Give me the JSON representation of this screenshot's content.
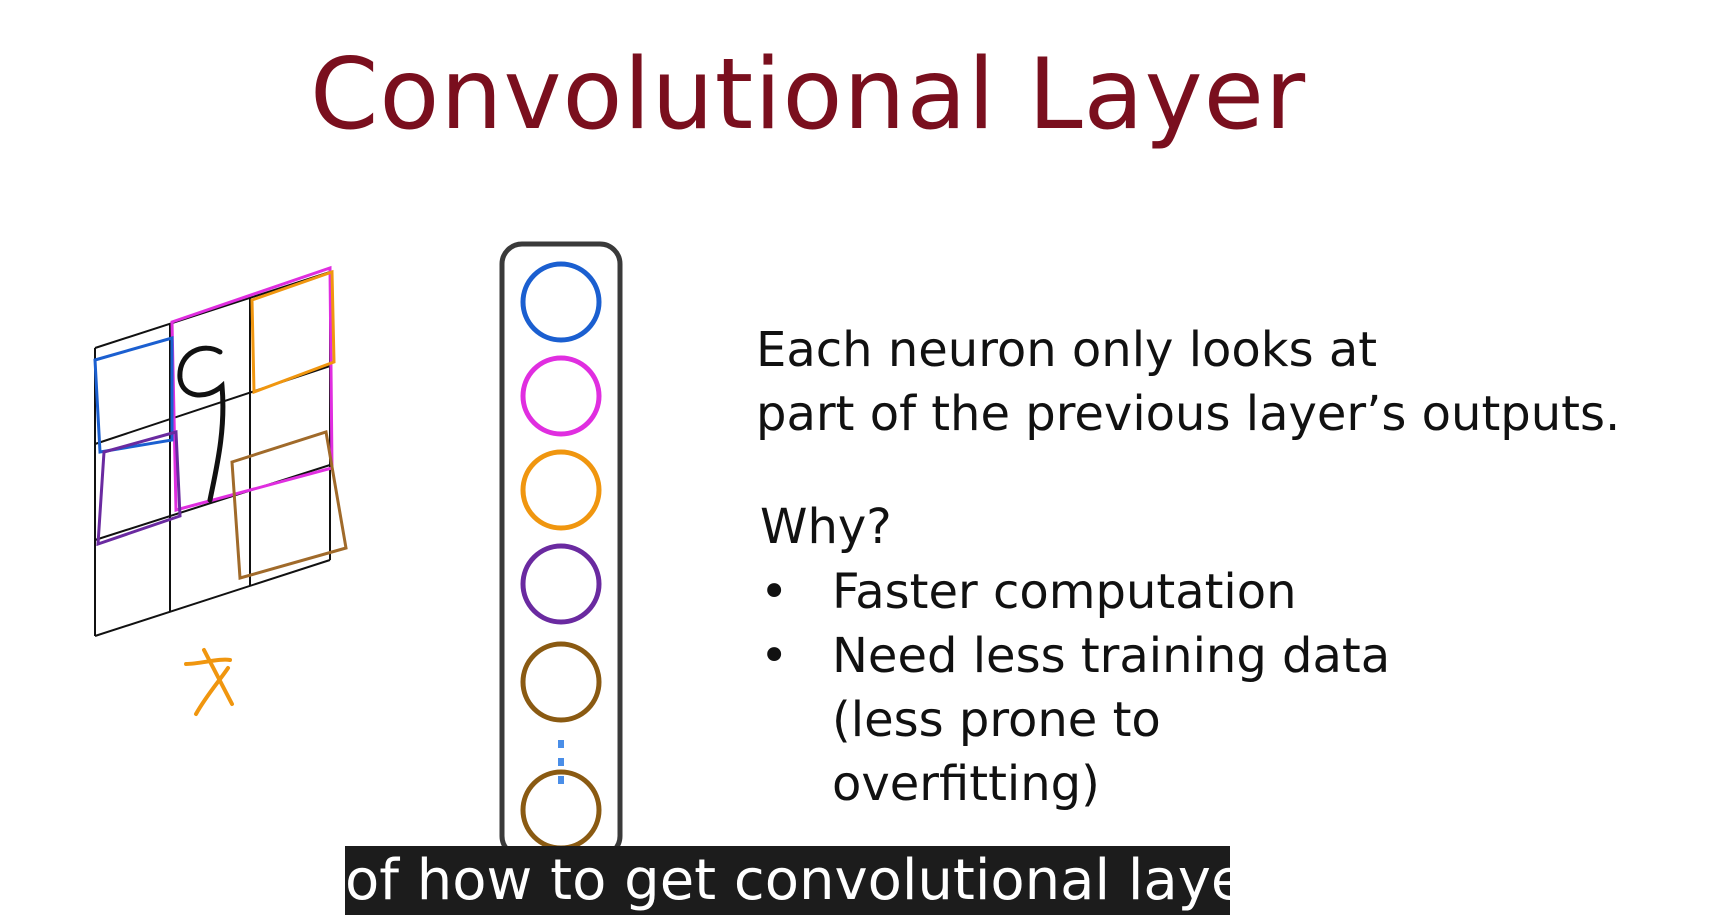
{
  "slide": {
    "title": "Convolutional Layer",
    "description_lines": [
      "Each neuron only looks at",
      "part of the previous layer’s outputs."
    ],
    "why_heading": "Why?",
    "bullets": [
      {
        "marker": "•",
        "lines": [
          "Faster computation"
        ]
      },
      {
        "marker": "•",
        "lines": [
          "Need less training data",
          "(less prone to",
          "overfitting)"
        ]
      }
    ]
  },
  "sketch": {
    "digit_label": "9",
    "input_label": "x",
    "neuron_colors": [
      "#1b5fd0",
      "#e02ee0",
      "#f0960f",
      "#6a2aa0",
      "#8a5a12",
      "#8a5a12"
    ],
    "ellipsis_color": "#4a8ee8",
    "patch_colors": {
      "blue": "#1b5fd0",
      "magenta": "#e02ee0",
      "orange": "#f0960f",
      "purple": "#6a2aa0",
      "brown": "#a06a2a"
    }
  },
  "caption": {
    "text": "of how to get convolutional layers"
  }
}
